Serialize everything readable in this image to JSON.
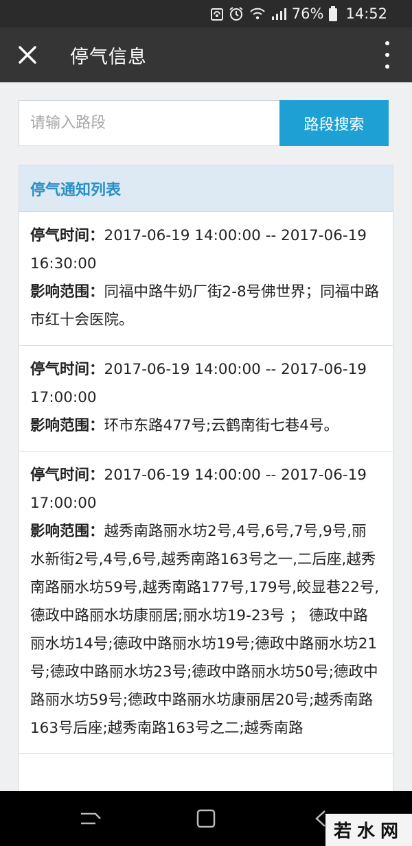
{
  "status_bar": {
    "battery": "76%",
    "time": "14:52",
    "icons": [
      "sync-icon",
      "alarm-icon",
      "wifi-icon",
      "signal-icon",
      "battery-icon"
    ]
  },
  "app_bar": {
    "title": "停气信息",
    "close_icon": "close-icon",
    "more_icon": "more-vertical-icon"
  },
  "search": {
    "placeholder": "请输入路段",
    "button_label": "路段搜索"
  },
  "panel": {
    "title": "停气通知列表",
    "items": [
      {
        "time_label": "停气时间：",
        "time_value": "2017-06-19 14:00:00 -- 2017-06-19 16:30:00",
        "scope_label": "影响范围：",
        "scope_value": "同福中路牛奶厂街2-8号佛世界；同福中路市红十会医院。"
      },
      {
        "time_label": "停气时间：",
        "time_value": "2017-06-19 14:00:00 -- 2017-06-19 17:00:00",
        "scope_label": "影响范围：",
        "scope_value": "环市东路477号;云鹤南街七巷4号。"
      },
      {
        "time_label": "停气时间：",
        "time_value": "2017-06-19 14:00:00 -- 2017-06-19 17:00:00",
        "scope_label": "影响范围：",
        "scope_value": "越秀南路丽水坊2号,4号,6号,7号,9号,丽水新街2号,4号,6号,越秀南路163号之一,二后座,越秀南路丽水坊59号,越秀南路177号,179号,皎显巷22号,德政中路丽水坊康丽居;丽水坊19-23号 ； 德政中路丽水坊14号;德政中路丽水坊19号;德政中路丽水坊21号;德政中路丽水坊23号;德政中路丽水坊50号;德政中路丽水坊59号;德政中路丽水坊康丽居20号;越秀南路163号后座;越秀南路163号之二;越秀南路"
      }
    ]
  },
  "nav_bar": {
    "icons": [
      "recent-apps-icon",
      "home-icon",
      "back-icon"
    ]
  },
  "watermark": {
    "text": "若水网"
  },
  "colors": {
    "accent": "#1ea0d4",
    "app_bar": "#353535",
    "panel_header_bg": "#dde9f3",
    "panel_header_text": "#2a8fc4"
  }
}
